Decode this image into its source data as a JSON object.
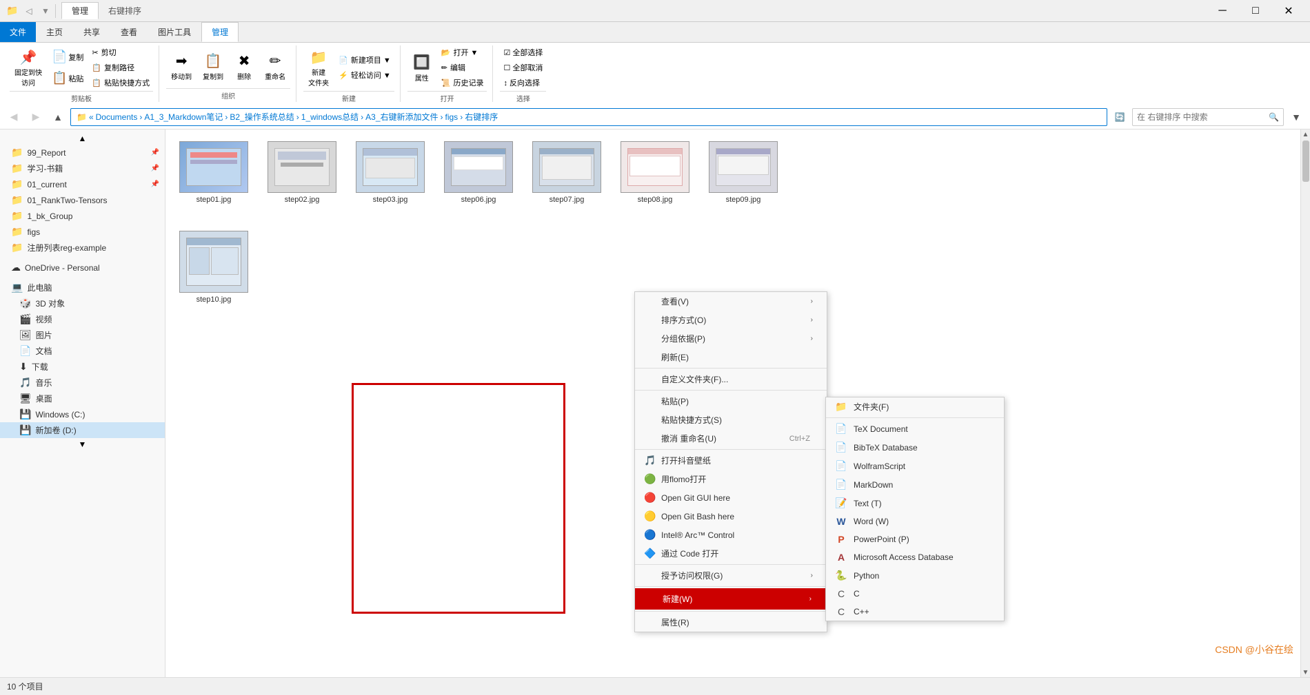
{
  "window": {
    "title": "右键排序",
    "controls": {
      "minimize": "─",
      "maximize": "□",
      "close": "✕"
    }
  },
  "ribbon_tabs": {
    "active_tab": "管理",
    "tabs": [
      "文件",
      "主页",
      "共享",
      "查看",
      "图片工具",
      "管理"
    ],
    "context_tab": "右键排序"
  },
  "ribbon_groups": {
    "clipboard": {
      "label": "剪贴板",
      "buttons": [
        "固定到快\n访问",
        "复制",
        "粘贴"
      ],
      "small_buttons": [
        "✂ 剪切",
        "📋 复制路径",
        "📋 粘贴快捷方式"
      ]
    },
    "organize": {
      "label": "组织",
      "buttons": [
        "移动到",
        "复制到",
        "删除",
        "重命名"
      ]
    },
    "new": {
      "label": "新建",
      "buttons": [
        "新建\n文件夹"
      ],
      "small_buttons": [
        "📄 新建项目▼",
        "⚡ 轻松访问▼"
      ]
    },
    "open": {
      "label": "打开",
      "buttons": [
        "属性"
      ],
      "small_buttons": [
        "📂 打开▼",
        "✏ 编辑",
        "📜 历史记录"
      ]
    },
    "select": {
      "label": "选择",
      "small_buttons": [
        "☑ 全部选择",
        "☐ 全部取消",
        "↕ 反向选择"
      ]
    }
  },
  "address_bar": {
    "path_parts": [
      "Documents",
      "A1_3_Markdown笔记",
      "B2_操作系统总结",
      "1_windows总结",
      "A3_右键新添加文件",
      "figs",
      "右键排序"
    ],
    "search_placeholder": "在 右键排序 中搜索"
  },
  "sidebar": {
    "items": [
      {
        "name": "99_Report",
        "type": "folder",
        "pinned": true
      },
      {
        "name": "学习-书籍",
        "type": "folder",
        "pinned": true
      },
      {
        "name": "01_current",
        "type": "folder",
        "pinned": true
      },
      {
        "name": "01_RankTwo-Tensors",
        "type": "folder"
      },
      {
        "name": "1_bk_Group",
        "type": "folder"
      },
      {
        "name": "figs",
        "type": "folder"
      },
      {
        "name": "注册列表reg-example",
        "type": "folder"
      },
      {
        "name": "OneDrive - Personal",
        "type": "cloud"
      },
      {
        "name": "此电脑",
        "type": "pc"
      },
      {
        "name": "3D 对象",
        "type": "3d"
      },
      {
        "name": "视频",
        "type": "video"
      },
      {
        "name": "图片",
        "type": "image"
      },
      {
        "name": "文档",
        "type": "doc"
      },
      {
        "name": "下载",
        "type": "download"
      },
      {
        "name": "音乐",
        "type": "music"
      },
      {
        "name": "桌面",
        "type": "desktop"
      },
      {
        "name": "Windows (C:)",
        "type": "drive"
      },
      {
        "name": "新加卷 (D:)",
        "type": "drive",
        "selected": true
      }
    ]
  },
  "files": [
    {
      "name": "step01.jpg",
      "thumb": "blue"
    },
    {
      "name": "step02.jpg",
      "thumb": "gray"
    },
    {
      "name": "step03.jpg",
      "thumb": "blue2"
    },
    {
      "name": "step06.jpg",
      "thumb": "blue3"
    },
    {
      "name": "step07.jpg",
      "thumb": "blue4"
    },
    {
      "name": "step08.jpg",
      "thumb": "red"
    },
    {
      "name": "step09.jpg",
      "thumb": "gray2"
    },
    {
      "name": "step10.jpg",
      "thumb": "blue5"
    }
  ],
  "context_menu": {
    "items": [
      {
        "id": "view",
        "label": "查看(V)",
        "has_arrow": true
      },
      {
        "id": "sort",
        "label": "排序方式(O)",
        "has_arrow": true
      },
      {
        "id": "group",
        "label": "分组依据(P)",
        "has_arrow": true
      },
      {
        "id": "refresh",
        "label": "刷新(E)"
      },
      {
        "separator": true
      },
      {
        "id": "customize",
        "label": "自定义文件夹(F)..."
      },
      {
        "separator": true
      },
      {
        "id": "paste",
        "label": "粘贴(P)"
      },
      {
        "id": "paste_shortcut",
        "label": "粘贴快捷方式(S)"
      },
      {
        "id": "undo",
        "label": "撤消 重命名(U)",
        "shortcut": "Ctrl+Z"
      },
      {
        "separator": true
      },
      {
        "id": "tiktok",
        "label": "打开抖音壁纸",
        "icon": "🎵"
      },
      {
        "id": "flomo",
        "label": "用flomo打开",
        "icon": "🟢"
      },
      {
        "id": "git_gui",
        "label": "Open Git GUI here",
        "icon": "🔴"
      },
      {
        "id": "git_bash",
        "label": "Open Git Bash here",
        "icon": "🟡"
      },
      {
        "id": "intel_arc",
        "label": "Intel® Arc™ Control",
        "icon": "🔵"
      },
      {
        "id": "vscode",
        "label": "通过 Code 打开",
        "icon": "🔷"
      },
      {
        "separator": true
      },
      {
        "id": "access",
        "label": "授予访问权限(G)",
        "has_arrow": true
      },
      {
        "separator": true
      },
      {
        "id": "new",
        "label": "新建(W)",
        "highlighted": true,
        "has_arrow": true
      },
      {
        "separator": true
      },
      {
        "id": "properties",
        "label": "属性(R)"
      }
    ]
  },
  "submenu": {
    "items": [
      {
        "id": "folder",
        "label": "文件夹(F)",
        "icon": "📁",
        "icon_color": "#e6ac00"
      },
      {
        "id": "tex",
        "label": "TeX Document",
        "icon": "📄"
      },
      {
        "id": "bibtex",
        "label": "BibTeX Database",
        "icon": "📄"
      },
      {
        "id": "wolfram",
        "label": "WolframScript",
        "icon": "📄"
      },
      {
        "id": "markdown",
        "label": "MarkDown",
        "icon": "📄"
      },
      {
        "id": "text",
        "label": "Text (T)",
        "icon": "📝"
      },
      {
        "id": "word",
        "label": "Word (W)",
        "icon": "W",
        "icon_color": "#2b579a"
      },
      {
        "id": "ppt",
        "label": "PowerPoint (P)",
        "icon": "P",
        "icon_color": "#d24726"
      },
      {
        "id": "access",
        "label": "Microsoft Access Database",
        "icon": "A",
        "icon_color": "#a4373a"
      },
      {
        "id": "python",
        "label": "Python",
        "icon": "🐍"
      },
      {
        "id": "c",
        "label": "C",
        "icon": "C"
      },
      {
        "id": "cpp",
        "label": "C++",
        "icon": "C"
      }
    ]
  },
  "status_bar": {
    "item_count": "10 个项目"
  },
  "watermark": "CSDN @小谷在绘"
}
